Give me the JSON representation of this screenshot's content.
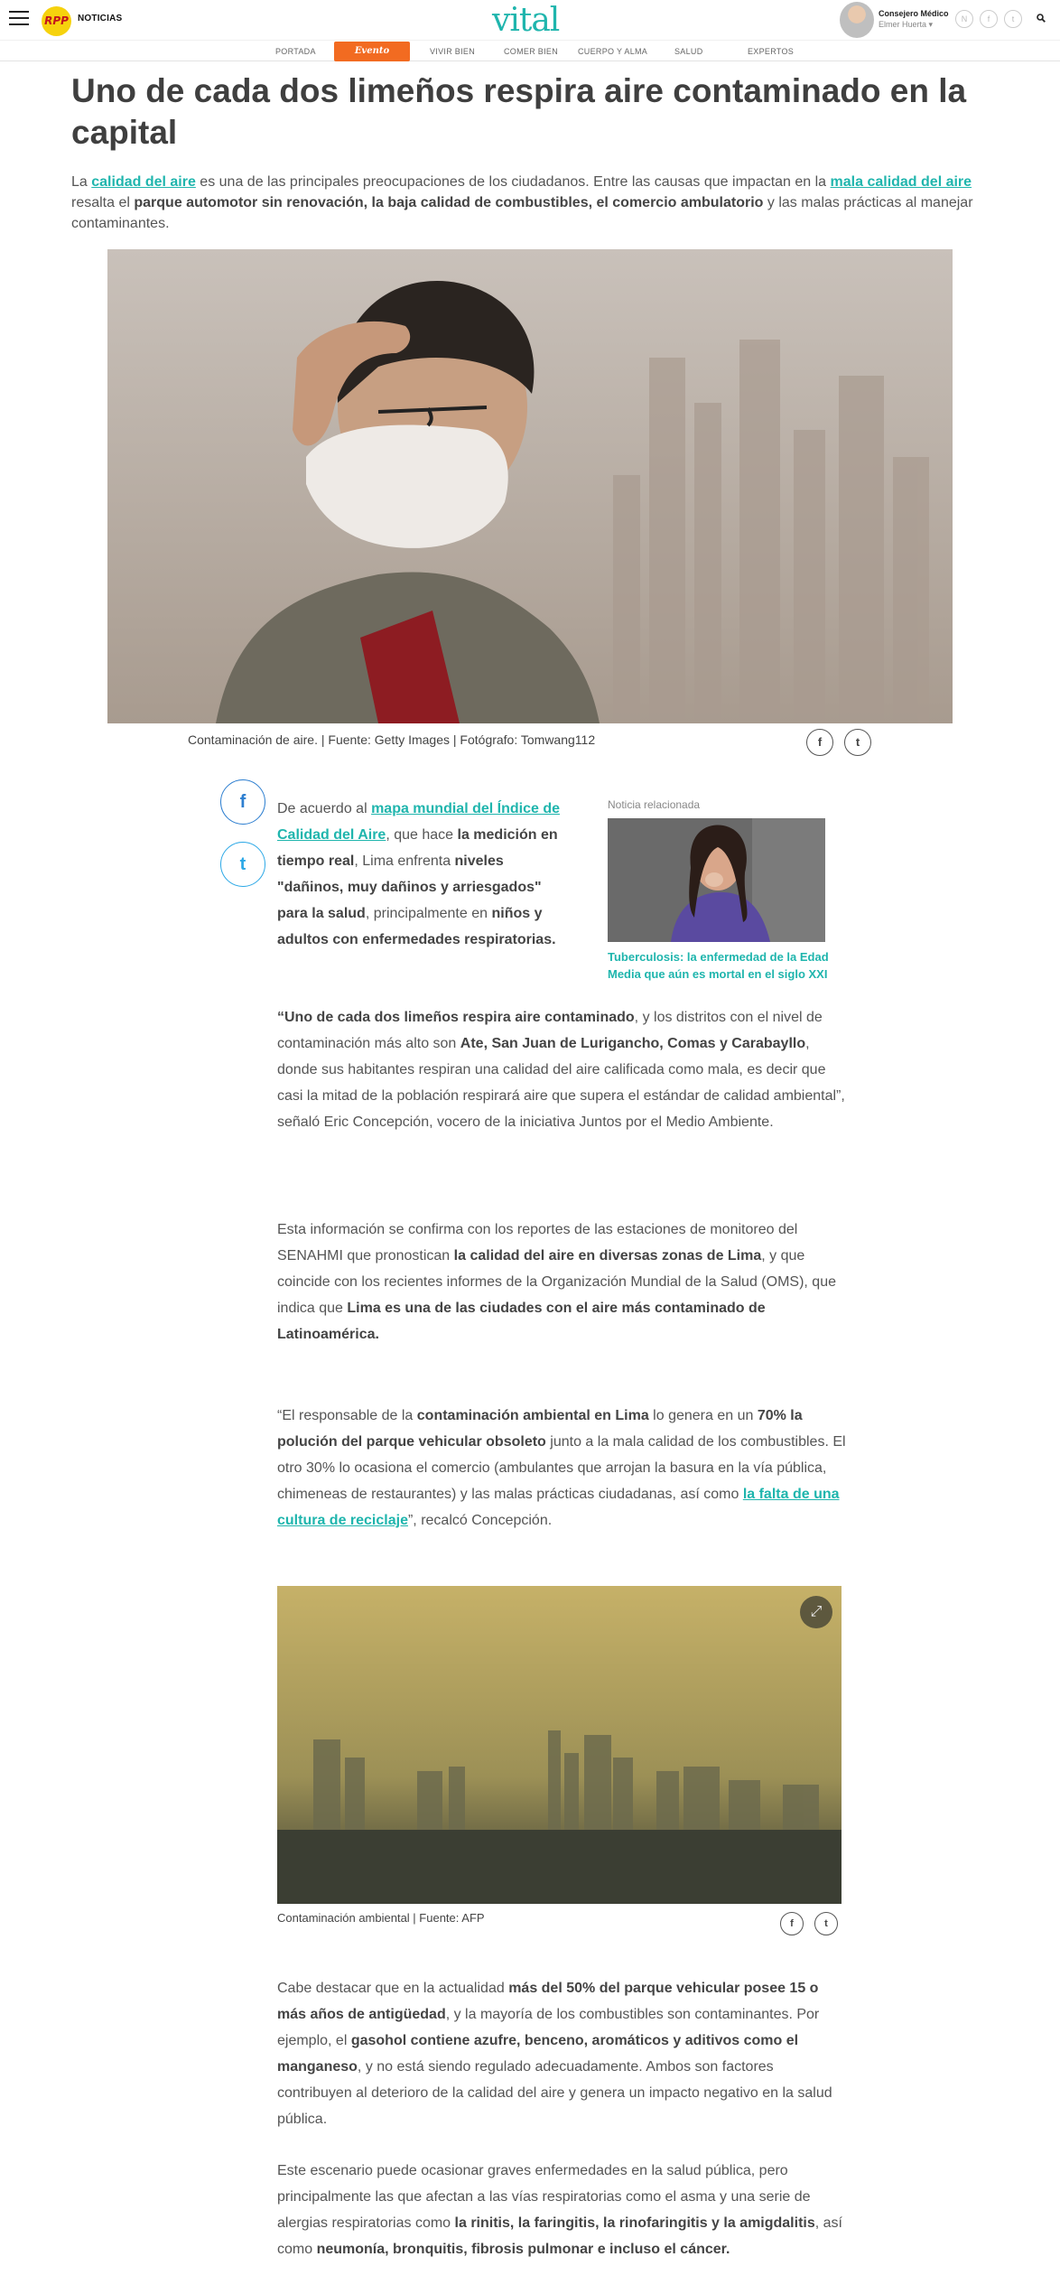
{
  "header": {
    "brand": "RPP",
    "brand_section": "NOTICIAS",
    "site_logo": "vital",
    "medico_title": "Consejero Médico",
    "medico_name": "Elmer Huerta",
    "medico_arrow": "▾",
    "social_icons": [
      "rss-icon",
      "facebook-icon",
      "twitter-icon"
    ],
    "social_glyphs": [
      "N",
      "f",
      "t"
    ],
    "search_icon": "search-icon"
  },
  "nav": {
    "items": [
      "PORTADA",
      "VIVIR BIEN",
      "COMER BIEN",
      "CUERPO Y ALMA",
      "SALUD",
      "EXPERTOS"
    ],
    "pill_label": "Evento Saludable"
  },
  "article": {
    "headline": "Uno de cada dos limeños respira aire contaminado en la capital",
    "lead": {
      "t1": "La ",
      "link1": "calidad del aire",
      "t2": " es una de las principales preocupaciones de los ciudadanos. Entre las causas que impactan en la ",
      "link2": "mala calidad del aire",
      "t3": " resalta el ",
      "b1": "parque automotor sin renovación, la baja calidad de combustibles, el comercio ambulatorio",
      "t4": " y las malas prácticas al manejar contaminantes."
    },
    "hero_caption": "Contaminación de aire. | Fuente: Getty Images | Fotógrafo: Tomwang112",
    "p1": {
      "t1": "De acuerdo al ",
      "link1": "mapa mundial del Índice de Calidad del Aire",
      "t2": ", que hace ",
      "b1": "la medición en tiempo real",
      "t3": ", Lima enfrenta ",
      "b2": "niveles \"dañinos, muy dañinos y arriesgados\" para la salud",
      "t4": ", principalmente en ",
      "b3": "niños y adultos con enfermedades respiratorias."
    },
    "related": {
      "label": "Noticia relacionada",
      "title": "Tuberculosis: la enfermedad de la Edad Media que aún es mortal en el siglo XXI"
    },
    "p2": {
      "b1": "“Uno de cada dos limeños respira aire contaminado",
      "t1": ", y los distritos con el nivel de contaminación más alto son ",
      "b2": "Ate, San Juan de Lurigancho, Comas y Carabayllo",
      "t2": ", donde sus habitantes respiran una calidad del aire calificada como mala, es decir que casi la mitad de la población respirará aire que supera el estándar de calidad ambiental”, señaló Eric Concepción, vocero de la iniciativa Juntos por el Medio Ambiente."
    },
    "p3": {
      "t1": "Esta información se confirma con los reportes de las estaciones de monitoreo del SENAHMI que pronostican ",
      "b1": "la calidad del aire en diversas zonas de Lima",
      "t2": ", y que coincide con los recientes informes de la Organización Mundial de la Salud (OMS), que indica que ",
      "b2": "Lima es una de las ciudades con el aire más contaminado de Latinoamérica."
    },
    "p4": {
      "t1": "“El responsable de la ",
      "b1": "contaminación ambiental en Lima",
      "t2": " lo genera en un ",
      "b2": "70% la polución del parque vehicular obsoleto",
      "t3": " junto a la mala calidad de los combustibles.  El otro 30% lo ocasiona el comercio (ambulantes que arrojan la basura en la vía pública, chimeneas de restaurantes) y las malas prácticas ciudadanas, así como ",
      "link1": "la falta de una cultura de reciclaje",
      "t4": "”, recalcó Concepción."
    },
    "city_caption": "Contaminación ambiental | Fuente: AFP",
    "p5": {
      "t1": "Cabe destacar que en la actualidad ",
      "b1": "más del 50% del parque vehicular posee 15 o más años de antigüedad",
      "t2": ", y la mayoría de los combustibles son contaminantes. Por ejemplo, el ",
      "b2": "gasohol contiene azufre, benceno, aromáticos y aditivos como el manganeso",
      "t3": ", y no está siendo regulado adecuadamente. Ambos son factores contribuyen al deterioro de la calidad del aire y genera un impacto negativo en la salud pública."
    },
    "p6": {
      "t1": "Este escenario puede ocasionar graves enfermedades en la salud pública, pero principalmente las que afectan a las vías respiratorias como el asma y una serie de alergias respiratorias como ",
      "b1": "la rinitis, la faringitis, la rinofaringitis y la amigdalitis",
      "t2": ", así como ",
      "b2": "neumonía, bronquitis, fibrosis pulmonar e incluso el cáncer."
    }
  },
  "share": {
    "facebook_glyph": "f",
    "twitter_glyph": "t",
    "expand_glyph": "⤢"
  },
  "colors": {
    "accent": "#1fb5ad",
    "pill": "#f26b21",
    "facebook": "#2e7fd0",
    "twitter": "#2ca8e6"
  }
}
